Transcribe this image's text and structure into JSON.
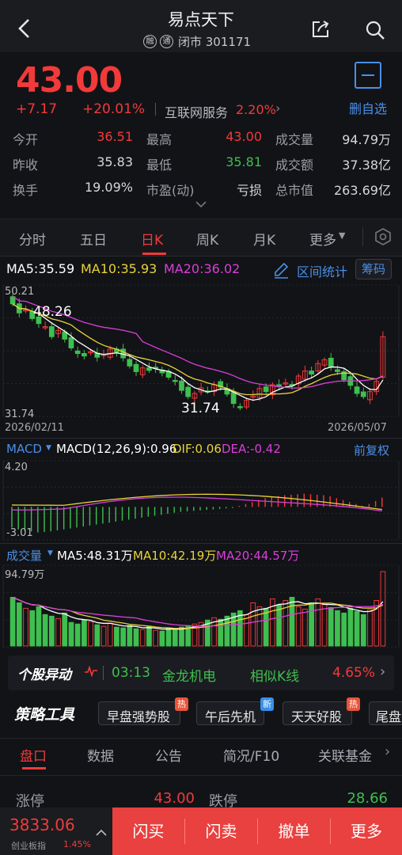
{
  "header": {
    "title": "易点天下",
    "badges": [
      "融",
      "通"
    ],
    "status": "闭市 301171"
  },
  "quote": {
    "price": "43.00",
    "change": "+7.17",
    "change_pct": "+20.01%",
    "sector": "互联网服务",
    "sector_pct": "2.20%",
    "watch_label": "删自选",
    "stats": [
      {
        "k": "今开",
        "v": "36.51",
        "c": "red"
      },
      {
        "k": "最高",
        "v": "43.00",
        "c": "red"
      },
      {
        "k": "成交量",
        "v": "94.79万",
        "c": "normal"
      },
      {
        "k": "昨收",
        "v": "35.83",
        "c": "normal"
      },
      {
        "k": "最低",
        "v": "35.81",
        "c": "green"
      },
      {
        "k": "成交额",
        "v": "37.38亿",
        "c": "normal"
      },
      {
        "k": "换手",
        "v": "19.09%",
        "c": "normal"
      },
      {
        "k": "市盈(动)",
        "v": "亏损",
        "c": "normal"
      },
      {
        "k": "总市值",
        "v": "263.69亿",
        "c": "normal"
      }
    ]
  },
  "period_tabs": {
    "items": [
      "分时",
      "五日",
      "日K",
      "周K",
      "月K",
      "更多"
    ],
    "active": 2
  },
  "ma_line": {
    "ma5": "MA5:35.59",
    "ma10": "MA10:35.93",
    "ma20": "MA20:36.02",
    "range_stats": "区间统计",
    "chips": "筹码"
  },
  "kchart": {
    "ymax": "50.21",
    "ymin": "31.74",
    "high_label": "48.26",
    "low_label": "31.74",
    "date_start": "2026/02/11",
    "date_end": "2026/05/07"
  },
  "macd": {
    "title": "MACD",
    "params": "MACD(12,26,9):0.96",
    "dif": "DIF:0.06",
    "dea": "DEA:-0.42",
    "adjust": "前复权",
    "ymax": "4.20",
    "ymin": "-3.01"
  },
  "volume": {
    "title": "成交量",
    "ma5": "MA5:48.31万",
    "ma10": "MA10:42.19万",
    "ma20": "MA20:44.57万",
    "ymax": "94.79万"
  },
  "ticker": {
    "label": "个股异动",
    "time": "03:13",
    "name": "金龙机电",
    "event": "相似K线",
    "pct": "4.65%"
  },
  "strategy": {
    "label": "策略工具",
    "items": [
      {
        "name": "早盘强势股",
        "badge": "热"
      },
      {
        "name": "午后先机",
        "badge": "新"
      },
      {
        "name": "天天好股",
        "badge": "热"
      },
      {
        "name": "尾盘",
        "badge": ""
      }
    ]
  },
  "info_tabs": {
    "items": [
      "盘口",
      "数据",
      "公告",
      "简况/F10",
      "关联基金"
    ],
    "active": 0
  },
  "limits": {
    "up_label": "涨停",
    "up": "43.00",
    "down_label": "跌停",
    "down": "28.66"
  },
  "bottom": {
    "index_value": "3833.06",
    "index_name": "创业板指",
    "index_pct": "1.45%",
    "buttons": [
      "闪买",
      "闪卖",
      "撤单",
      "更多"
    ]
  },
  "colors": {
    "up": "#f23a3a",
    "down": "#3fbf4f",
    "accent": "#4a8fe7",
    "ma5": "#ffffff",
    "ma10": "#e8d33a",
    "ma20": "#d93fd9",
    "bar_red": "#e83a3a"
  },
  "chart_data": [
    {
      "type": "candlestick",
      "title": "日K",
      "x_range": [
        "2026/02/11",
        "2026/05/07"
      ],
      "ylim": [
        31.74,
        50.21
      ],
      "max_label": 48.26,
      "min_label": 31.74,
      "close": [
        48.26,
        46.8,
        47.3,
        45.9,
        45.1,
        44.6,
        43.0,
        44.0,
        42.6,
        41.2,
        40.3,
        39.9,
        40.6,
        39.7,
        40.2,
        41.0,
        40.5,
        39.6,
        38.3,
        37.4,
        38.0,
        37.6,
        37.9,
        37.2,
        36.5,
        35.9,
        34.4,
        33.4,
        33.9,
        34.8,
        34.2,
        35.3,
        34.9,
        33.8,
        32.3,
        31.74,
        32.8,
        33.5,
        34.7,
        34.2,
        35.3,
        35.0,
        35.6,
        35.2,
        36.7,
        37.5,
        37.0,
        38.7,
        39.3,
        38.2,
        37.4,
        36.1,
        35.2,
        33.9,
        33.4,
        34.2,
        35.83,
        43.0
      ],
      "ma5_end": 35.59,
      "ma10_end": 35.93,
      "ma20_end": 36.02
    },
    {
      "type": "bar",
      "title": "MACD",
      "params": "12,26,9",
      "ylim": [
        -3.01,
        4.2
      ],
      "values": [
        -2.1,
        -2.3,
        -2.4,
        -2.5,
        -2.6,
        -2.55,
        -2.5,
        -2.4,
        -2.3,
        -2.2,
        -2.1,
        -2.0,
        -1.9,
        -1.8,
        -1.7,
        -1.6,
        -1.5,
        -1.4,
        -1.3,
        -1.2,
        -1.1,
        -1.0,
        -0.9,
        -0.8,
        -0.7,
        -0.6,
        -0.5,
        -0.45,
        -0.4,
        -0.35,
        -0.3,
        -0.25,
        -0.2,
        -0.15,
        -0.1,
        0.1,
        0.3,
        0.5,
        0.7,
        0.9,
        1.0,
        1.1,
        1.2,
        1.25,
        1.3,
        1.35,
        1.3,
        1.25,
        1.2,
        1.1,
        0.9,
        0.7,
        0.5,
        0.3,
        0.1,
        0.3,
        0.6,
        0.96
      ],
      "dif_end": 0.06,
      "dea_end": -0.42
    },
    {
      "type": "bar",
      "title": "成交量",
      "unit": "万",
      "ylim": [
        0,
        94.79
      ],
      "values": [
        62,
        55,
        48,
        45,
        50,
        40,
        38,
        35,
        42,
        30,
        28,
        33,
        31,
        27,
        25,
        29,
        24,
        23,
        26,
        22,
        21,
        25,
        20,
        19,
        23,
        21,
        24,
        26,
        28,
        30,
        33,
        36,
        34,
        38,
        42,
        45,
        40,
        55,
        50,
        48,
        60,
        52,
        58,
        62,
        50,
        47,
        55,
        60,
        53,
        49,
        45,
        42,
        48,
        44,
        40,
        46,
        58,
        94.79
      ],
      "ma5_end": 48.31,
      "ma10_end": 42.19,
      "ma20_end": 44.57
    }
  ]
}
